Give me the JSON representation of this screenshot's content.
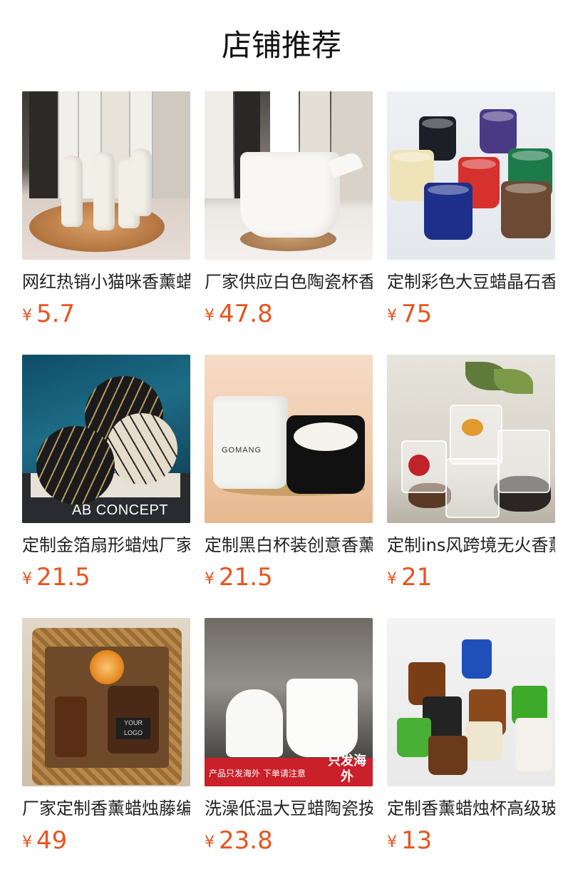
{
  "page": {
    "title": "店铺推荐"
  },
  "colors": {
    "price": "#e8541e",
    "text": "#222222",
    "background": "#ffffff"
  },
  "products": [
    {
      "name": "网红热销小猫咪香薰蜡烛",
      "currency": "¥",
      "price": "5.7",
      "image": "cat-candles-photo"
    },
    {
      "name": "厂家供应白色陶瓷杯香薰蜡烛",
      "currency": "¥",
      "price": "47.8",
      "image": "ceramic-pitcher-photo"
    },
    {
      "name": "定制彩色大豆蜡晶石香薰蜡烛",
      "currency": "¥",
      "price": "75",
      "image": "colored-jars-photo"
    },
    {
      "name": "定制金箔扇形蜡烛厂家",
      "currency": "¥",
      "price": "21.5",
      "image": "gold-foil-discs-photo",
      "photo_text": "AB CONCEPT"
    },
    {
      "name": "定制黑白杯装创意香薰蜡烛",
      "currency": "¥",
      "price": "21.5",
      "image": "black-white-cups-photo",
      "photo_text": "GOMANG"
    },
    {
      "name": "定制ins风跨境无火香薰",
      "currency": "¥",
      "price": "21",
      "image": "glass-bottles-photo"
    },
    {
      "name": "厂家定制香薰蜡烛藤编礼盒",
      "currency": "¥",
      "price": "49",
      "image": "basket-gift-photo",
      "photo_text": "YOUR LOGO"
    },
    {
      "name": "洗澡低温大豆蜡陶瓷按摩蜡烛",
      "currency": "¥",
      "price": "23.8",
      "image": "ceramic-set-photo",
      "banner_text": "产品只发海外 下单请注意",
      "badge_text": "只发海外"
    },
    {
      "name": "定制香薰蜡烛杯高级玻璃罐",
      "currency": "¥",
      "price": "13",
      "image": "amber-green-jars-photo"
    }
  ]
}
